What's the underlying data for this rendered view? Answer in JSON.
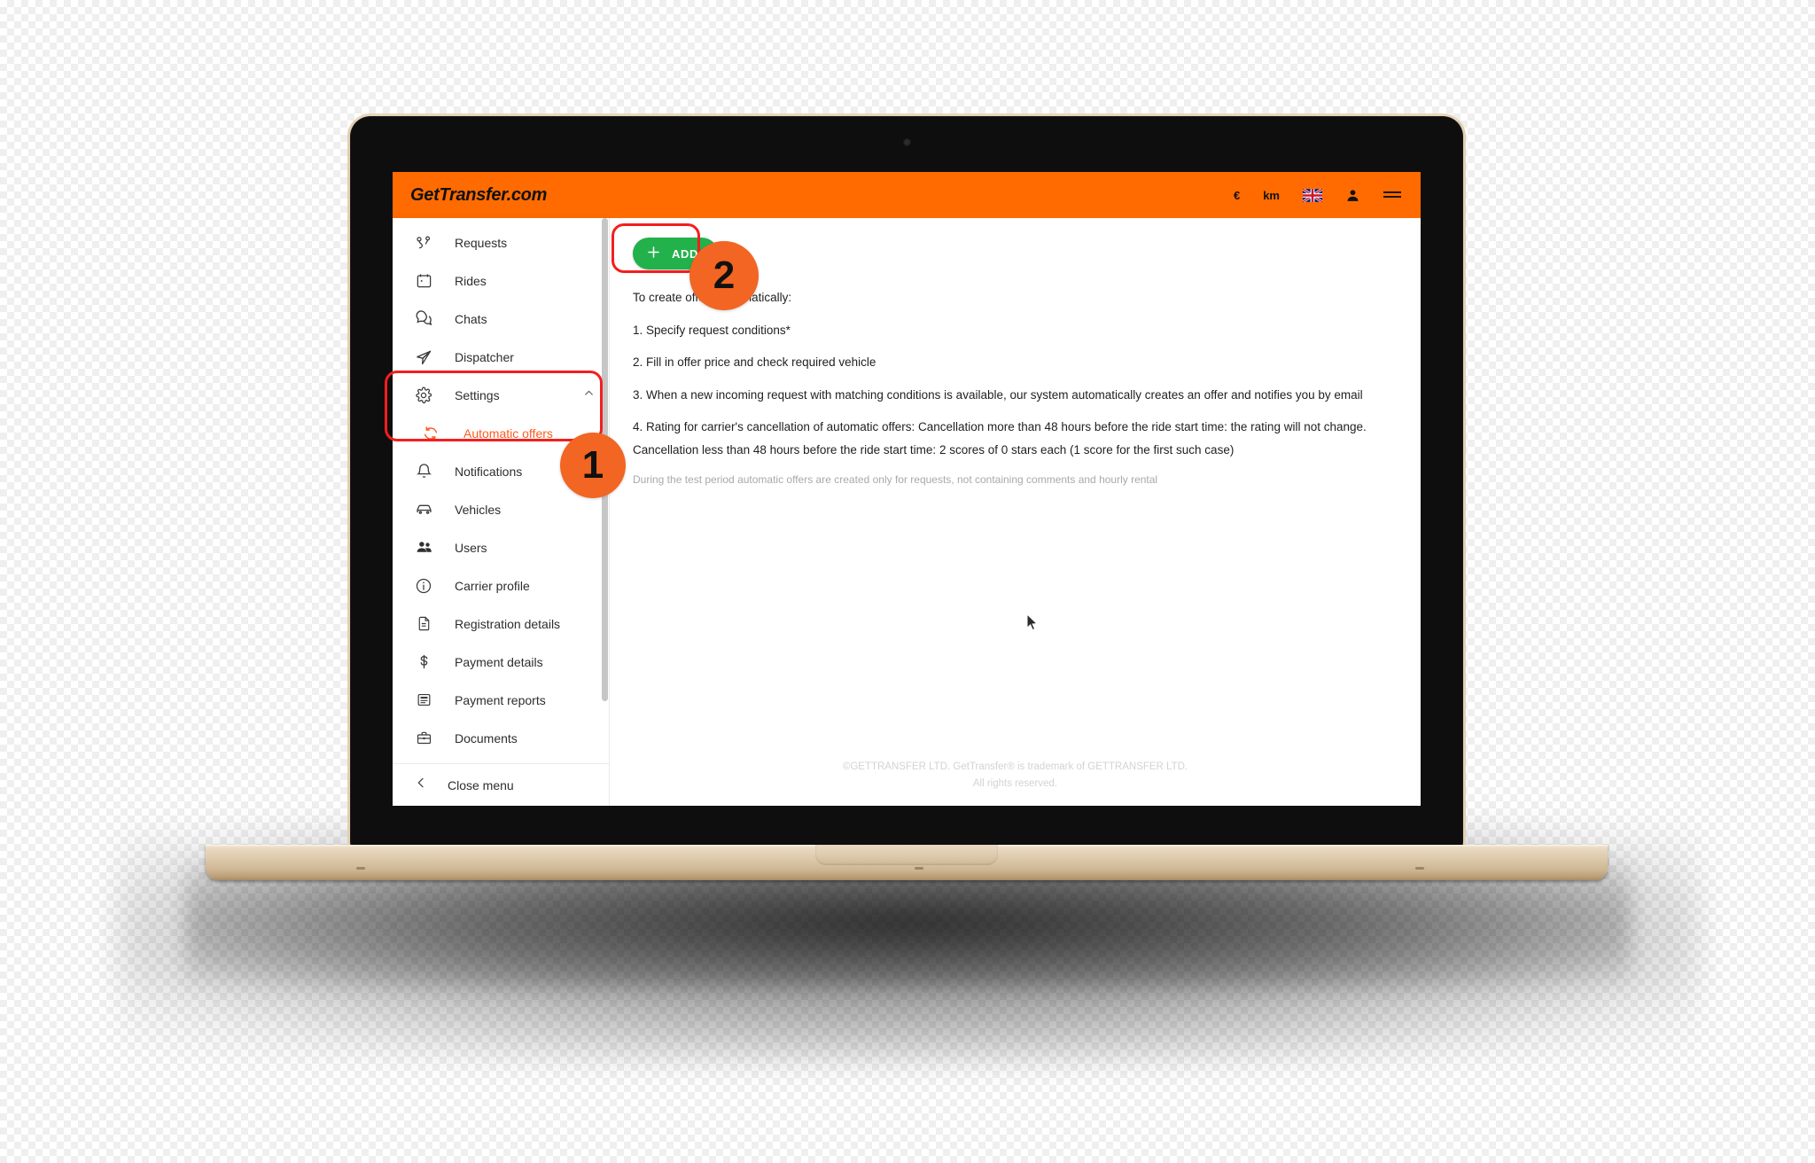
{
  "header": {
    "brand": "GetTransfer.com",
    "currency": "€",
    "distance_unit": "km",
    "language_flag": "uk-flag-icon",
    "account_icon": "person-icon",
    "menu_icon": "hamburger-menu-icon"
  },
  "sidebar": {
    "items": [
      {
        "label": "Requests",
        "icon": "route-pin-icon",
        "active": false
      },
      {
        "label": "Rides",
        "icon": "calendar-icon",
        "active": false
      },
      {
        "label": "Chats",
        "icon": "chat-bubbles-icon",
        "active": false
      },
      {
        "label": "Dispatcher",
        "icon": "paper-plane-icon",
        "active": false
      },
      {
        "label": "Settings",
        "icon": "gear-icon",
        "active": false,
        "expanded": true,
        "chevron": "chevron-up-icon"
      },
      {
        "label": "Automatic offers",
        "icon": "refresh-icon",
        "active": true,
        "sub": true
      },
      {
        "label": "Notifications",
        "icon": "bell-icon",
        "active": false
      },
      {
        "label": "Vehicles",
        "icon": "car-icon",
        "active": false
      },
      {
        "label": "Users",
        "icon": "users-icon",
        "active": false
      },
      {
        "label": "Carrier profile",
        "icon": "info-circle-icon",
        "active": false
      },
      {
        "label": "Registration details",
        "icon": "document-icon",
        "active": false
      },
      {
        "label": "Payment details",
        "icon": "dollar-icon",
        "active": false
      },
      {
        "label": "Payment reports",
        "icon": "report-icon",
        "active": false
      },
      {
        "label": "Documents",
        "icon": "briefcase-icon",
        "active": false
      }
    ],
    "close_menu": {
      "label": "Close menu",
      "icon": "chevron-left-icon"
    }
  },
  "main": {
    "add_button": {
      "label": "ADD",
      "icon": "plus-icon"
    },
    "intro": "To create offers automatically:",
    "steps": [
      "1. Specify request conditions*",
      "2. Fill in offer price and check required vehicle",
      "3. When a new incoming request with matching conditions is available, our system automatically creates an offer and notifies you by email",
      "4. Rating for carrier's cancellation of automatic offers: Cancellation more than 48 hours before the ride start time: the rating will not change.",
      "Cancellation less than 48 hours before the ride start time: 2 scores of 0 stars each (1 score for the first such case)"
    ],
    "note": "During the test period automatic offers are created only for requests, not containing comments and hourly rental"
  },
  "footer": {
    "line1": "©GETTRANSFER LTD. GetTransfer® is trademark of GETTRANSFER LTD.",
    "line2": "All rights reserved."
  },
  "annotations": {
    "badge1": "1",
    "badge2": "2",
    "highlight_color": "#f41e1e",
    "badge_color": "#f26522"
  },
  "colors": {
    "header_orange": "#ff6b00",
    "accent_orange": "#ff5a1f",
    "add_green": "#23b14c",
    "text_dark": "#1f1f1f",
    "muted": "#a9a9a9"
  }
}
